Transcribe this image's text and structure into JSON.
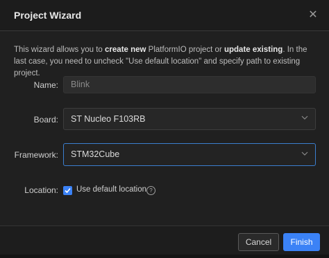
{
  "dialog": {
    "title": "Project Wizard",
    "description": {
      "p1": "This wizard allows you to ",
      "b1": "create new",
      "p2": " PlatformIO project or ",
      "b2": "update existing",
      "p3": ". In the last case, you need to uncheck \"Use default location\" and specify path to existing project."
    }
  },
  "form": {
    "name": {
      "label": "Name:",
      "value": "Blink"
    },
    "board": {
      "label": "Board:",
      "value": "ST Nucleo F103RB"
    },
    "framework": {
      "label": "Framework:",
      "value": "STM32Cube"
    },
    "location": {
      "label": "Location:",
      "checkbox_label": "Use default location",
      "checked": true,
      "help_glyph": "?"
    }
  },
  "footer": {
    "cancel_label": "Cancel",
    "finish_label": "Finish"
  },
  "colors": {
    "accent": "#3b82f6",
    "focus_border": "#3b7fd0"
  },
  "icons": {
    "close": "close-icon",
    "chevron": "chevron-down-icon",
    "check": "check-icon",
    "help": "help-icon"
  }
}
